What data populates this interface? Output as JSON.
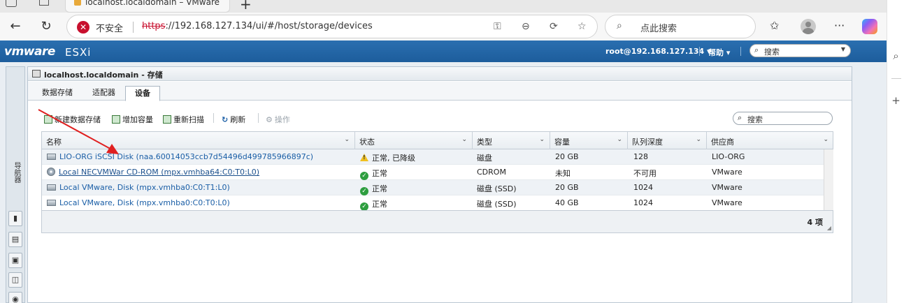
{
  "browser": {
    "tab_title": "localhost.localdomain – VMware ESXi",
    "new_tab": "+",
    "insecure_label": "不安全",
    "url_scheme": "https",
    "url_rest": "://192.168.127.134/ui/#/host/storage/devices",
    "search_placeholder": "点此搜索"
  },
  "esxi": {
    "logo": "vmware",
    "product": "ESXi",
    "user": "root@192.168.127.134 ▾",
    "help": "帮助 ▾",
    "search_placeholder": "搜索",
    "rail_label": "导航器",
    "panel_title": "localhost.localdomain - 存储",
    "tabs": [
      "数据存储",
      "适配器",
      "设备"
    ],
    "actions": {
      "new_datastore": "新建数据存储",
      "increase_capacity": "增加容量",
      "rescan": "重新扫描",
      "refresh": "刷新",
      "actions": "操作"
    },
    "grid_search_placeholder": "搜索",
    "columns": [
      "名称",
      "状态",
      "类型",
      "容量",
      "队列深度",
      "供应商"
    ],
    "rows": [
      {
        "name": "LIO-ORG iSCSI Disk (naa.60014053ccb7d54496d499785966897c)",
        "status": "正常, 已降级",
        "type": "磁盘",
        "capacity": "20 GB",
        "queue": "128",
        "vendor": "LIO-ORG"
      },
      {
        "name": "Local NECVMWar CD-ROM (mpx.vmhba64:C0:T0:L0)",
        "status": "正常",
        "type": "CDROM",
        "capacity": "未知",
        "queue": "不可用",
        "vendor": "VMware"
      },
      {
        "name": "Local VMware, Disk (mpx.vmhba0:C0:T1:L0)",
        "status": "正常",
        "type": "磁盘 (SSD)",
        "capacity": "20 GB",
        "queue": "1024",
        "vendor": "VMware"
      },
      {
        "name": "Local VMware, Disk (mpx.vmhba0:C0:T0:L0)",
        "status": "正常",
        "type": "磁盘 (SSD)",
        "capacity": "40 GB",
        "queue": "1024",
        "vendor": "VMware"
      }
    ],
    "item_count": "4 项"
  },
  "colors": {
    "header_blue": "#1d5d9c",
    "link_blue": "#1a5ea6",
    "ok_green": "#2e9e3f",
    "warn_yellow": "#f0c020",
    "annotation_red": "#e02020"
  }
}
